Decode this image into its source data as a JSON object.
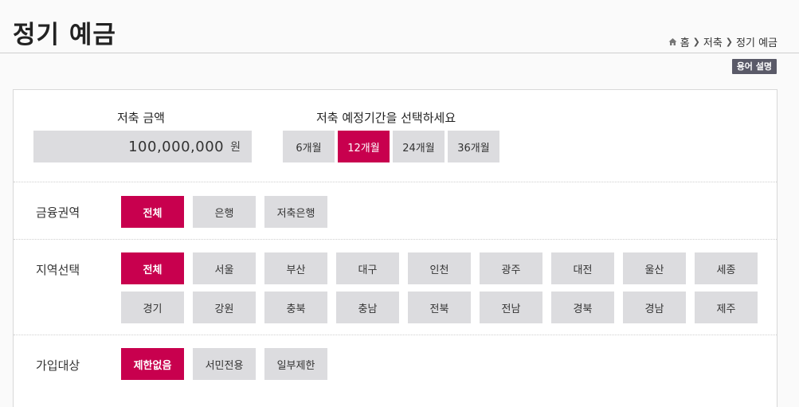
{
  "header": {
    "title": "정기 예금",
    "breadcrumb": [
      "홈",
      "저축",
      "정기 예금"
    ],
    "glossary_label": "용어 설명"
  },
  "amount": {
    "label": "저축 금액",
    "value": "100,000,000",
    "unit": "원"
  },
  "period": {
    "label": "저축 예정기간을 선택하세요",
    "options": [
      "6개월",
      "12개월",
      "24개월",
      "36개월"
    ],
    "selected": "12개월"
  },
  "finance_area": {
    "label": "금융권역",
    "options": [
      "전체",
      "은행",
      "저축은행"
    ],
    "selected": "전체"
  },
  "region": {
    "label": "지역선택",
    "options": [
      "전체",
      "서울",
      "부산",
      "대구",
      "인천",
      "광주",
      "대전",
      "울산",
      "세종",
      "경기",
      "강원",
      "충북",
      "충남",
      "전북",
      "전남",
      "경북",
      "경남",
      "제주"
    ],
    "selected": "전체"
  },
  "target": {
    "label": "가입대상",
    "options": [
      "제한없음",
      "서민전용",
      "일부제한"
    ],
    "selected": "제한없음"
  },
  "colors": {
    "accent": "#c8004e",
    "button_bg": "#dcdcdf",
    "badge_bg": "#5a5a68"
  },
  "icons": {
    "home": "home-icon",
    "separator": "chevron-right-icon"
  }
}
